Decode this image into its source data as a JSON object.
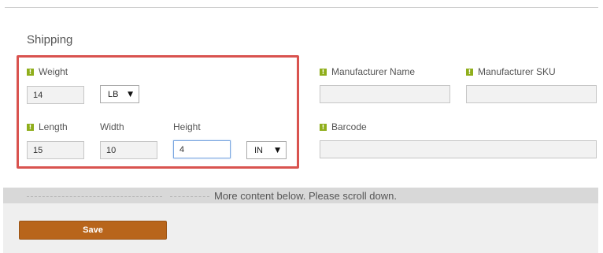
{
  "section": {
    "title": "Shipping"
  },
  "weight": {
    "label": "Weight",
    "value": "14",
    "unit": "LB"
  },
  "dimensions": {
    "length": {
      "label": "Length",
      "value": "15"
    },
    "width": {
      "label": "Width",
      "value": "10"
    },
    "height": {
      "label": "Height",
      "value": "4"
    },
    "unit": "IN"
  },
  "manufacturer_name": {
    "label": "Manufacturer Name",
    "value": ""
  },
  "manufacturer_sku": {
    "label": "Manufacturer SKU",
    "value": ""
  },
  "barcode": {
    "label": "Barcode",
    "value": ""
  },
  "scroll_notice": "More content below. Please scroll down.",
  "footer": {
    "save_label": "Save"
  },
  "icons": {
    "required": "required-field-icon",
    "caret": "dropdown-caret-icon"
  },
  "colors": {
    "highlight": "#d9534f",
    "required_icon": "#8fae1b",
    "save_button": "#b8651b",
    "focus_border": "#7aa7e0"
  }
}
